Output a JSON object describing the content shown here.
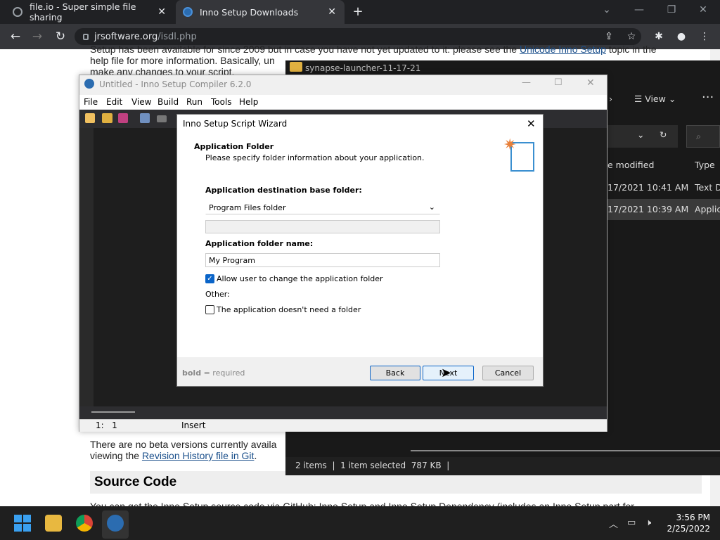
{
  "browser": {
    "tabs": [
      {
        "title": "file.io - Super simple file sharing",
        "active": false
      },
      {
        "title": "Inno Setup Downloads",
        "active": true
      }
    ],
    "url_domain": "jrsoftware.org",
    "url_path": "/isdl.php"
  },
  "webpage": {
    "para1_line1": "Setup has been available for since 2009 but in case you have not yet updated to it: please see the",
    "para1_link": "Unicode Inno Setup",
    "para1_after": "topic in the",
    "para1_line2": "help file for more information. Basically, un",
    "para1_line3": "make any changes to your script.",
    "para2_line1": "There are no beta versions currently availa",
    "para2_prefix": "viewing the",
    "para2_link": "Revision History file in Git",
    "section_heading": "Source Code",
    "para3": "You can get the Inno Setup source code via GitHub: Inno Setup and Inno Setup Dependency (includes an Inno Setup part for..."
  },
  "explorer": {
    "title": "synapse-launcher-11-17-21",
    "view_label": "View",
    "col_modified": "e modified",
    "col_type": "Type",
    "rows": [
      {
        "modified": "17/2021 10:41 AM",
        "type": "Text Do"
      },
      {
        "modified": "17/2021 10:39 AM",
        "type": "Applica"
      }
    ],
    "status_items": "2 items",
    "status_selected": "1 item selected",
    "status_size": "787 KB"
  },
  "inno": {
    "title": "Untitled - Inno Setup Compiler 6.2.0",
    "menu": [
      "File",
      "Edit",
      "View",
      "Build",
      "Run",
      "Tools",
      "Help"
    ],
    "status_pos": "1:   1",
    "status_mode": "Insert"
  },
  "wizard": {
    "title": "Inno Setup Script Wizard",
    "heading": "Application Folder",
    "subheading": "Please specify folder information about your application.",
    "base_folder_label": "Application destination base folder:",
    "base_folder_value": "Program Files folder",
    "custom_folder_value": "",
    "folder_name_label": "Application folder name:",
    "folder_name_value": "My Program",
    "allow_change_label": "Allow user to change the application folder",
    "allow_change_checked": true,
    "other_label": "Other:",
    "no_folder_label": "The application doesn't need a folder",
    "no_folder_checked": false,
    "footer_hint_bold": "bold",
    "footer_hint_rest": " = required",
    "back_label": "Back",
    "next_label": "Next",
    "cancel_label": "Cancel"
  },
  "taskbar": {
    "time": "3:56 PM",
    "date": "2/25/2022"
  },
  "colors": {
    "accent": "#0a64c8",
    "chrome_dark": "#202124",
    "taskbar": "#1f1f1f"
  }
}
